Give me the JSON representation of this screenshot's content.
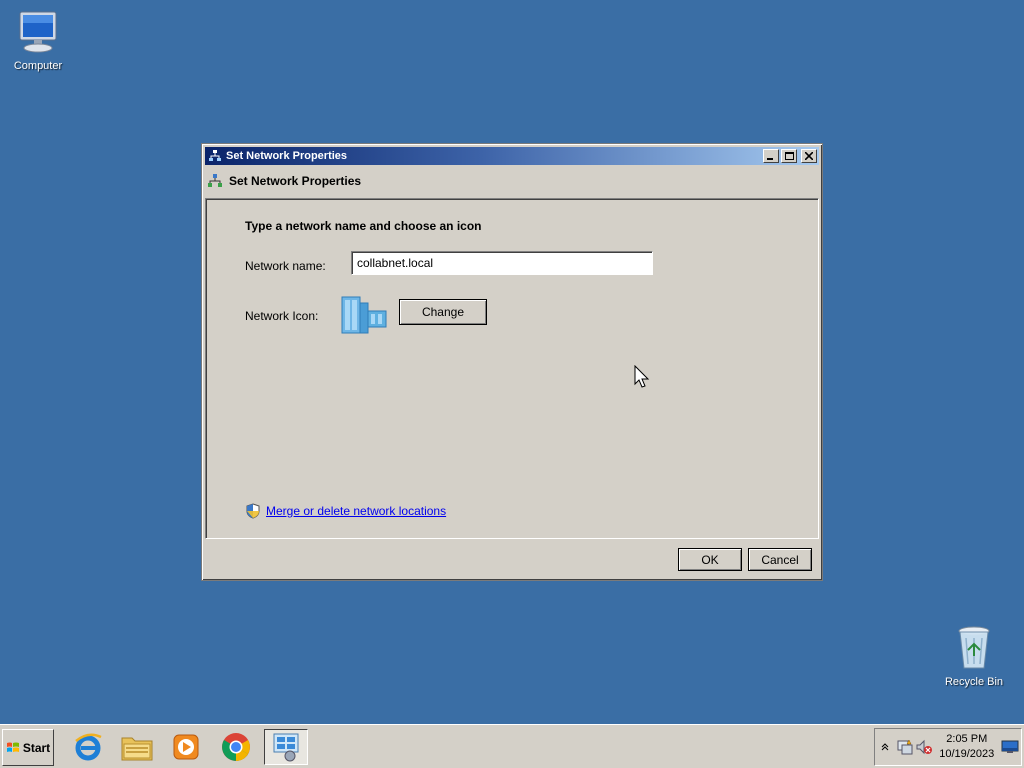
{
  "desktop": {
    "icons": [
      {
        "label": "Computer"
      },
      {
        "label": "Recycle Bin"
      }
    ]
  },
  "dialog": {
    "title": "Set Network Properties",
    "header": "Set Network Properties",
    "heading": "Type a network name and choose an icon",
    "network_name_label": "Network name:",
    "network_name_value": "collabnet.local",
    "network_icon_label": "Network Icon:",
    "change_label": "Change",
    "merge_link": "Merge or delete network locations",
    "ok_label": "OK",
    "cancel_label": "Cancel"
  },
  "taskbar": {
    "start_label": "Start",
    "apps": [
      {
        "icon": "internet-explorer-icon"
      },
      {
        "icon": "file-explorer-icon"
      },
      {
        "icon": "media-player-icon"
      },
      {
        "icon": "chrome-icon"
      },
      {
        "icon": "network-control-panel-icon",
        "active": true
      }
    ],
    "clock_time": "2:05 PM",
    "clock_date": "10/19/2023"
  },
  "colors": {
    "desktop": "#3a6ea5",
    "title_gradient_start": "#0a246a",
    "title_gradient_end": "#a6caf0",
    "dialog_face": "#d4d0c8",
    "link": "#0000ee"
  }
}
